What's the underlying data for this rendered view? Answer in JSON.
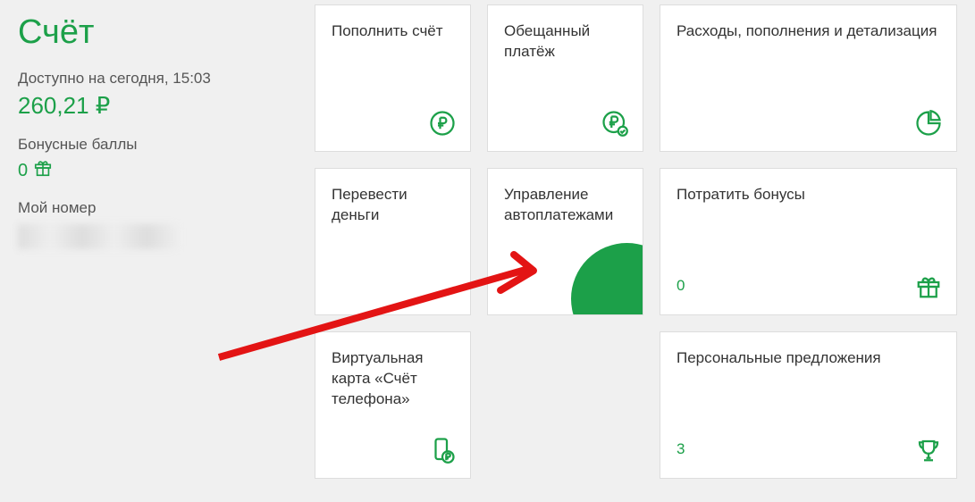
{
  "sidebar": {
    "title": "Счёт",
    "available_label": "Доступно на сегодня, 15:03",
    "balance": "260,21 ₽",
    "bonus_label": "Бонусные баллы",
    "bonus_value": "0",
    "number_label": "Мой номер"
  },
  "cards": {
    "topup": {
      "title": "Пополнить счёт"
    },
    "promised": {
      "title": "Обещанный платёж"
    },
    "expenses": {
      "title": "Расходы, пополнения и детализация"
    },
    "transfer": {
      "title": "Перевести деньги"
    },
    "autopay": {
      "title": "Управление автоплатежами"
    },
    "spend_bonus": {
      "title": "Потратить бонусы",
      "value": "0"
    },
    "virtual_card": {
      "title": "Виртуальная карта «Счёт телефона»"
    },
    "personal": {
      "title": "Персональные предложения",
      "value": "3"
    }
  }
}
